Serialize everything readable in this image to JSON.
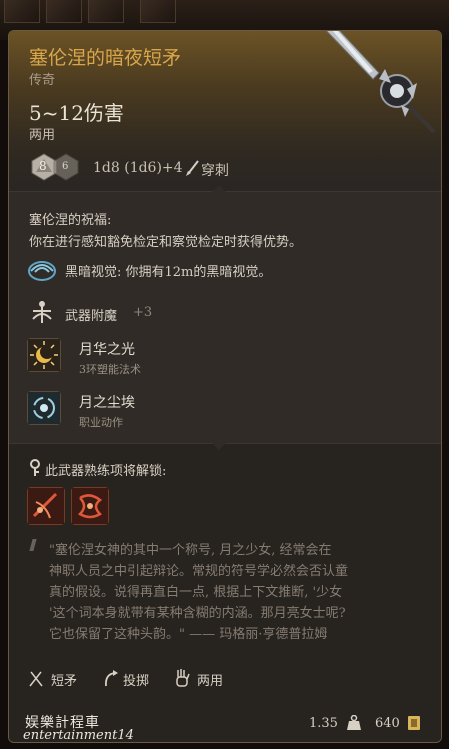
{
  "item": {
    "name": "塞伦涅的暗夜短矛",
    "rarity": "传奇",
    "damage": "5~12伤害",
    "handedness": "两用",
    "dice": {
      "die_primary": "8",
      "die_secondary": "6",
      "formula": "1d8 (1d6)+4",
      "damage_type": "穿刺"
    },
    "blessing": {
      "title": "塞伦涅的祝福:",
      "description": "你在进行感知豁免检定和察觉检定时获得优势。"
    },
    "darkvision": "黑暗视觉: 你拥有12m的黑暗视觉。",
    "enchantment": {
      "label": "武器附魔",
      "value": "+3"
    },
    "spells": [
      {
        "name": "月华之光",
        "subtitle": "3环塑能法术",
        "icon": "moon-sun-icon"
      },
      {
        "name": "月之尘埃",
        "subtitle": "职业动作",
        "icon": "moon-dust-icon"
      }
    ],
    "unlock": {
      "label": "此武器熟练项将解锁:",
      "actions": [
        {
          "icon": "weapon-action-slash-icon"
        },
        {
          "icon": "weapon-action-thrust-icon"
        }
      ]
    },
    "quote_lines": [
      "\"塞伦涅女神的其中一个称号, 月之少女, 经常会在",
      "神职人员之中引起辩论。常规的符号学必然会否认童",
      "真的假设。说得再直白一点, 根据上下文推断, '少女",
      "'这个词本身就带有某种含糊的内涵。那月亮女士呢?",
      "它也保留了这种头韵。\" —— 玛格丽·亨德普拉姆"
    ],
    "properties": [
      {
        "label": "短矛",
        "icon": "spear-icon"
      },
      {
        "label": "投掷",
        "icon": "throw-icon"
      },
      {
        "label": "两用",
        "icon": "versatile-hand-icon"
      }
    ],
    "weight": "1.35",
    "price": "640"
  },
  "watermark": {
    "line1": "娱樂計程車",
    "line2": "entertainment14"
  },
  "colors": {
    "title_gold": "#d9a64a",
    "header_gradient_top": "#6b5326",
    "panel_bg": "#302b27",
    "body_text": "#d8d0c4",
    "muted_text": "#857c72"
  }
}
